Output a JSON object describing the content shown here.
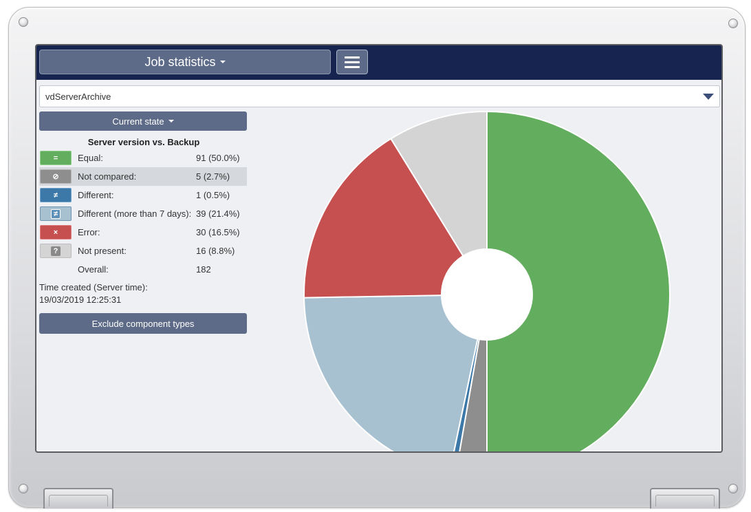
{
  "header": {
    "title": "Job statistics"
  },
  "selector": {
    "value": "vdServerArchive"
  },
  "panel": {
    "state_button": "Current state",
    "section_title": "Server version vs. Backup",
    "rows": [
      {
        "symbol": "=",
        "label": "Equal:",
        "value": "91  (50.0%)",
        "color": "#63ad5e",
        "border": "#8fd08a",
        "icon": "equal-icon"
      },
      {
        "symbol": "⊘",
        "label": "Not compared:",
        "value": "5  (2.7%)",
        "color": "#8e8e8e",
        "border": "#b5b5b5",
        "icon": "not-compared-icon"
      },
      {
        "symbol": "≠",
        "label": "Different:",
        "value": "1  (0.5%)",
        "color": "#3c78a8",
        "border": "#6fa3cc",
        "icon": "not-equal-icon"
      },
      {
        "symbol": "≠",
        "label": "Different (more than 7 days):",
        "value": "39  (21.4%)",
        "color": "#a8c1d1",
        "border": "#6f95b3",
        "icon": "not-equal-boxed-icon"
      },
      {
        "symbol": "×",
        "label": "Error:",
        "value": "30  (16.5%)",
        "color": "#c65050",
        "border": "#e07f7f",
        "icon": "error-x-icon"
      },
      {
        "symbol": "?",
        "label": "Not present:",
        "value": "16  (8.8%)",
        "color": "#d4d4d4",
        "border": "#bdbdbd",
        "icon": "question-icon"
      }
    ],
    "overall_label": "Overall:",
    "overall_value": "182",
    "time_label": "Time created (Server time):",
    "time_value": "19/03/2019 12:25:31",
    "exclude_button": "Exclude component types"
  },
  "chart_data": {
    "type": "pie",
    "donut": true,
    "start": "12 o'clock",
    "direction": "clockwise",
    "series": [
      {
        "name": "Equal",
        "value": 91,
        "color": "#63ad5e"
      },
      {
        "name": "Not compared",
        "value": 5,
        "color": "#8e8e8e"
      },
      {
        "name": "Different",
        "value": 1,
        "color": "#3c78a8"
      },
      {
        "name": "Different (more than 7 days)",
        "value": 39,
        "color": "#a8c1d1"
      },
      {
        "name": "Error",
        "value": 30,
        "color": "#c65050"
      },
      {
        "name": "Not present",
        "value": 16,
        "color": "#d4d4d4"
      }
    ]
  }
}
